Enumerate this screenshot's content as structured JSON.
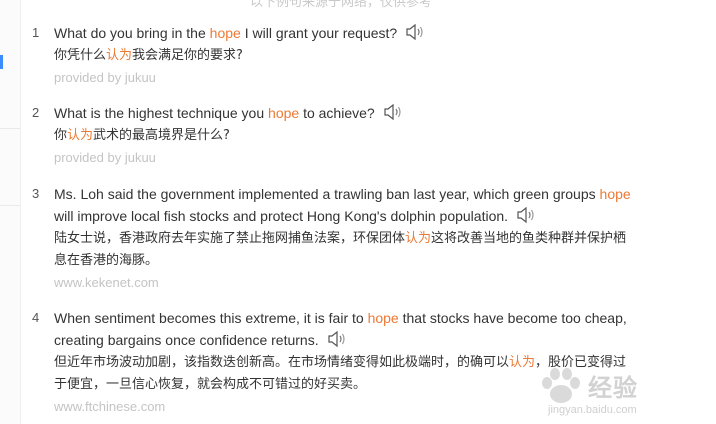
{
  "header_faded": "以下例句来源于网络，仅供参考",
  "speaker_icon": "speaker-icon",
  "accent_color": "#ec7a35",
  "entries": [
    {
      "num": "1",
      "en_before": "What do you bring in the ",
      "en_hl": "hope",
      "en_after": " I will grant your request?",
      "cn_before": "你凭什么",
      "cn_hl": "认为",
      "cn_after": "我会满足你的要求?",
      "source": "provided by jukuu"
    },
    {
      "num": "2",
      "en_before": "What is the highest technique you ",
      "en_hl": "hope",
      "en_after": " to achieve?",
      "cn_before": "你",
      "cn_hl": "认为",
      "cn_after": "武术的最高境界是什么?",
      "source": "provided by jukuu"
    },
    {
      "num": "3",
      "en_before": "Ms. Loh said the government implemented a trawling ban last year, which green groups ",
      "en_hl": "hope",
      "en_after": " will improve local fish stocks and protect Hong Kong's dolphin population.",
      "cn_before": "陆女士说，香港政府去年实施了禁止拖网捕鱼法案，环保团体",
      "cn_hl": "认为",
      "cn_after": "这将改善当地的鱼类种群并保护栖息在香港的海豚。",
      "source": "www.kekenet.com"
    },
    {
      "num": "4",
      "en_before": "When sentiment becomes this extreme, it is fair to ",
      "en_hl": "hope",
      "en_after": " that stocks have become too cheap, creating bargains once confidence returns.",
      "cn_before": "但近年市场波动加剧，该指数迭创新高。在市场情绪变得如此极端时，的确可以",
      "cn_hl": "认为",
      "cn_after": "，股价已变得过于便宜，一旦信心恢复，就会构成不可错过的好买卖。",
      "source": "www.ftchinese.com"
    }
  ],
  "watermark": {
    "text": "经验",
    "url": "jingyan.baidu.com"
  }
}
